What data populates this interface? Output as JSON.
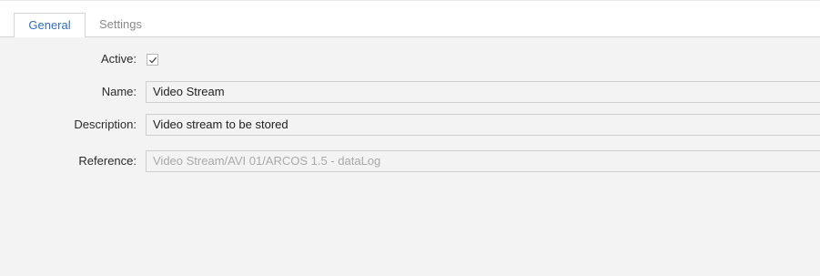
{
  "tabs": [
    {
      "label": "General",
      "active": true
    },
    {
      "label": "Settings",
      "active": false
    }
  ],
  "form": {
    "active": {
      "label": "Active:",
      "checked": true
    },
    "name": {
      "label": "Name:",
      "value": "Video Stream"
    },
    "description": {
      "label": "Description:",
      "value": "Video stream to be stored"
    },
    "reference": {
      "label": "Reference:",
      "value": "Video Stream/AVI 01/ARCOS 1.5 - dataLog",
      "readonly": true
    }
  },
  "colors": {
    "active_tab_text": "#2f6fb8",
    "inactive_tab_text": "#8a8a8a",
    "panel_background": "#f3f3f3",
    "readonly_text": "#a9a9a9"
  },
  "icons": {
    "checkbox_mark": "check-icon"
  }
}
